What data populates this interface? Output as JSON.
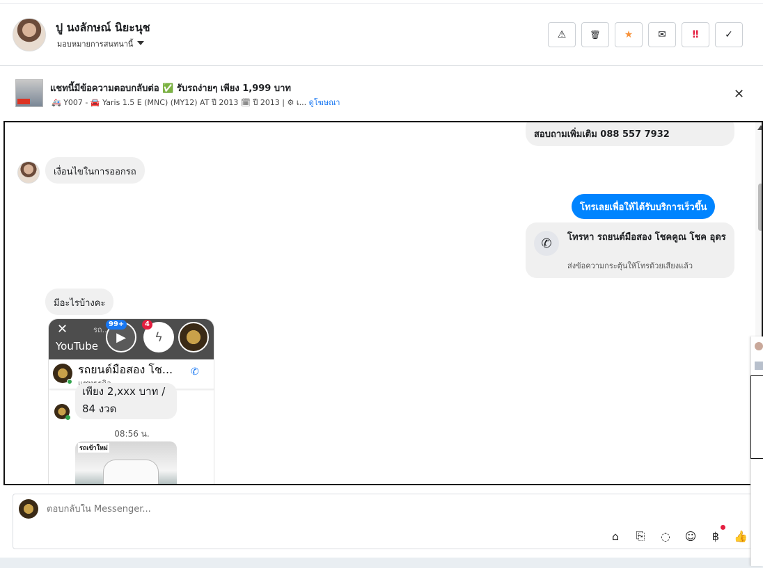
{
  "header": {
    "contact_name": "ปู นงลักษณ์ นิยะนุช",
    "assign_label": "มอบหมายการสนทนานี้",
    "actions": [
      {
        "name": "report-button",
        "icon": "warning-icon",
        "glyph": "⚠"
      },
      {
        "name": "delete-button",
        "icon": "trash-icon",
        "glyph": "🗑"
      },
      {
        "name": "star-button",
        "icon": "star-icon",
        "glyph": "★"
      },
      {
        "name": "mark-unread-button",
        "icon": "envelope-icon",
        "glyph": "✉"
      },
      {
        "name": "follow-up-button",
        "icon": "exclamation-icon",
        "glyph": "‼"
      },
      {
        "name": "mark-done-button",
        "icon": "check-icon",
        "glyph": "✓"
      }
    ]
  },
  "ad": {
    "title": "แชทนี้มีข้อความตอบกลับต่อ ✅ รับรถง่ายๆ เพียง 1,999 บาท",
    "subtitle": "🚑 Y007 - 🚘 Yaris 1.5 E (MNC) (MY12) AT ปี 2013 🗓 ปี 2013 | ⚙ เ...",
    "view_ad_link": "ดูโฆษณา",
    "close_glyph": "✕"
  },
  "messages": {
    "top_outgoing": "สอบถามเพิ่มเติม 088 557 7932",
    "incoming_1": "เงื่อนไขในการออกรถ",
    "outgoing_blue": "โทรเลยเพื่อให้ได้รับบริการเร็วขึ้น",
    "call_card": {
      "title": "โทรหา รถยนต์มือสอง โชคคูณ โชค อุดร",
      "description": "ส่งข้อความกระตุ้นให้โทรด้วยเสียงแล้ว"
    },
    "incoming_2": "มีอะไรบ้างคะ"
  },
  "screenshot": {
    "close_glyph": "✕",
    "youtube_text": "YouTube",
    "dim_text": "รถ...",
    "badge_youtube": "99+",
    "badge_messenger": "4",
    "card_name": "รถยนต์มือสอง โช...",
    "card_sub": "แชทธุรกิจ",
    "msg_text": "เพียง 2,xxx บาท / 84 งวด",
    "time": "08:56 น.",
    "img_tag": "รถเข้าใหม่"
  },
  "composer": {
    "placeholder": "ตอบกลับใน Messenger..."
  },
  "colors": {
    "accent_blue": "#0084ff",
    "link_blue": "#1877f2",
    "bubble_grey": "#f0f0f0",
    "star_orange": "#f7923a",
    "alert_red": "#e41e3f"
  }
}
